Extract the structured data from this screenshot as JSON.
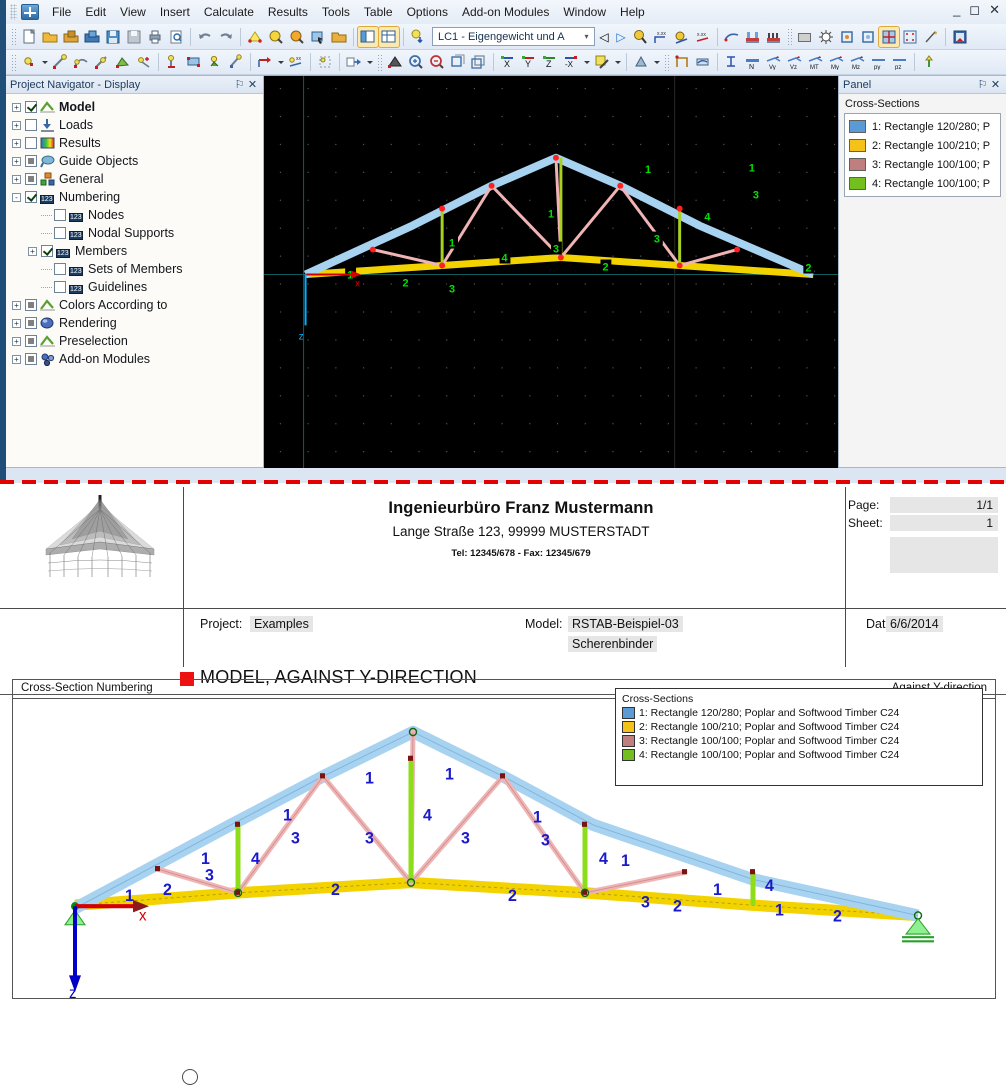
{
  "app": {
    "menu": [
      "File",
      "Edit",
      "View",
      "Insert",
      "Calculate",
      "Results",
      "Tools",
      "Table",
      "Options",
      "Add-on Modules",
      "Window",
      "Help"
    ],
    "window_controls": [
      "minimize",
      "restore",
      "close"
    ],
    "load_case": {
      "value": "LC1 - Eigengewicht und A",
      "arrow": "▾"
    },
    "toolbar_labels": [
      "N",
      "Vₓ",
      "Vᴢ",
      "Mₜ",
      "Mᵧ",
      "Mᶻ",
      "pᵧ",
      "pᶻ"
    ]
  },
  "navigator": {
    "title": "Project Navigator - Display",
    "pin": "⚐",
    "close": "✕",
    "items": [
      {
        "label": "Model",
        "level": 0,
        "expand": "+",
        "check": "checked",
        "bold": true,
        "icon": "model-icon"
      },
      {
        "label": "Loads",
        "level": 0,
        "expand": "+",
        "check": "empty",
        "bold": false,
        "icon": "loads-icon"
      },
      {
        "label": "Results",
        "level": 0,
        "expand": "+",
        "check": "empty",
        "bold": false,
        "icon": "results-icon"
      },
      {
        "label": "Guide Objects",
        "level": 0,
        "expand": "+",
        "check": "gray",
        "bold": false,
        "icon": "guide-objects-icon"
      },
      {
        "label": "General",
        "level": 0,
        "expand": "+",
        "check": "gray",
        "bold": false,
        "icon": "general-icon"
      },
      {
        "label": "Numbering",
        "level": 0,
        "expand": "-",
        "check": "checked",
        "bold": false,
        "icon": "numbering-icon"
      },
      {
        "label": "Nodes",
        "level": 1,
        "expand": "",
        "check": "empty",
        "bold": false,
        "icon": "numbering-icon"
      },
      {
        "label": "Nodal Supports",
        "level": 1,
        "expand": "",
        "check": "empty",
        "bold": false,
        "icon": "numbering-icon"
      },
      {
        "label": "Members",
        "level": 1,
        "expand": "+",
        "check": "checked",
        "bold": false,
        "icon": "numbering-icon"
      },
      {
        "label": "Sets of Members",
        "level": 1,
        "expand": "",
        "check": "empty",
        "bold": false,
        "icon": "numbering-icon"
      },
      {
        "label": "Guidelines",
        "level": 1,
        "expand": "",
        "check": "empty",
        "bold": false,
        "icon": "numbering-icon"
      },
      {
        "label": "Colors According to",
        "level": 0,
        "expand": "+",
        "check": "gray",
        "bold": false,
        "icon": "colors-icon"
      },
      {
        "label": "Rendering",
        "level": 0,
        "expand": "+",
        "check": "gray",
        "bold": false,
        "icon": "rendering-icon"
      },
      {
        "label": "Preselection",
        "level": 0,
        "expand": "+",
        "check": "gray",
        "bold": false,
        "icon": "preselection-icon"
      },
      {
        "label": "Add-on Modules",
        "level": 0,
        "expand": "+",
        "check": "gray",
        "bold": false,
        "icon": "addon-icon"
      }
    ]
  },
  "panel": {
    "title": "Panel",
    "pin": "⚐",
    "close": "✕",
    "section_label": "Cross-Sections",
    "items": [
      {
        "text": "1: Rectangle 120/280; P",
        "color": "#5b9bd5"
      },
      {
        "text": "2: Rectangle 100/210; P",
        "color": "#f5c21a"
      },
      {
        "text": "3: Rectangle 100/100; P",
        "color": "#c07f7f"
      },
      {
        "text": "4: Rectangle 100/100; P",
        "color": "#72bf1f"
      }
    ]
  },
  "printout": {
    "company": {
      "name": "Ingenieurbüro Franz Mustermann",
      "address": "Lange Straße 123, 99999 MUSTERSTADT",
      "contact": "Tel: 12345/678 - Fax: 12345/679"
    },
    "page_label": "Page:",
    "page_value": "1/1",
    "sheet_label": "Sheet:",
    "sheet_value": "1",
    "project_label": "Project:",
    "project_value": "Examples",
    "model_label": "Model:",
    "model_value": "RSTAB-Beispiel-03",
    "model_value2": "Scherenbinder",
    "date_label": "Date:",
    "date_value": "6/6/2014",
    "main_title": "MODEL, AGAINST Y-DIRECTION",
    "figure_caption_left": "Cross-Section Numbering",
    "figure_caption_right": "Against Y-direction",
    "legend_title": "Cross-Sections",
    "legend_items": [
      {
        "text": "1: Rectangle 120/280; Poplar and Softwood Timber C24",
        "color": "#5b9bd5"
      },
      {
        "text": "2: Rectangle 100/210; Poplar and Softwood Timber C24",
        "color": "#f5c21a"
      },
      {
        "text": "3: Rectangle 100/100; Poplar and Softwood Timber C24",
        "color": "#c07f7f"
      },
      {
        "text": "4: Rectangle 100/100; Poplar and Softwood Timber C24",
        "color": "#72bf1f"
      }
    ],
    "axis_labels": {
      "x": "x",
      "z": "z"
    }
  },
  "model": {
    "member_number_labels": [
      "1",
      "2",
      "3",
      "4"
    ],
    "colors": {
      "cs1": "#a7d2f0",
      "cs2": "#f2d300",
      "cs3": "#f0b4b4",
      "cs4": "#8ddd18",
      "label": "#1a1acc",
      "node": "#7a1414",
      "support": "#55e055",
      "axis_x": "#d40000",
      "axis_z": "#0000c8"
    },
    "top_chord_labels": [
      "1",
      "1",
      "1",
      "1",
      "1",
      "1",
      "1",
      "1"
    ],
    "bottom_chord_labels": [
      "2",
      "2",
      "2",
      "2",
      "2"
    ],
    "diagonal_labels": [
      "3",
      "3",
      "3",
      "3",
      "3",
      "3"
    ],
    "post_labels": [
      "4",
      "4",
      "4",
      "4"
    ]
  }
}
